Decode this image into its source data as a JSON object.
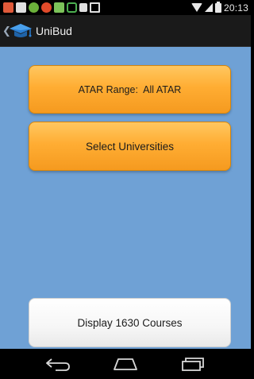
{
  "status_bar": {
    "time": "20:13",
    "notification_icons": [
      {
        "name": "app-notification-icon",
        "color": "#e05a3a"
      },
      {
        "name": "message-notification-icon",
        "color": "#e0e0e0"
      },
      {
        "name": "app-notification-icon",
        "color": "#6bb13a"
      },
      {
        "name": "app-notification-icon",
        "color": "#e04a2a"
      },
      {
        "name": "app-notification-icon",
        "color": "#7cc35a"
      },
      {
        "name": "shopping-bag-icon",
        "color": "#4caf50"
      },
      {
        "name": "notification-icon",
        "color": "#e0e0e0"
      },
      {
        "name": "inbox-icon",
        "color": "#e0e0e0"
      }
    ],
    "system_icons": [
      "wifi-icon",
      "signal-icon",
      "battery-icon"
    ]
  },
  "action_bar": {
    "title": "UniBud",
    "logo_icon": "graduation-cap-icon",
    "back_icon": "chevron-left-icon"
  },
  "main": {
    "atar_button_label": "ATAR Range:  All ATAR",
    "universities_button_label": "Select Universities",
    "display_button_label": "Display 1630 Courses"
  },
  "nav_bar": {
    "buttons": [
      "back-nav-icon",
      "home-nav-icon",
      "recent-apps-icon"
    ]
  },
  "colors": {
    "background": "#6fa1d5",
    "button_orange": "#ffad33",
    "button_white": "#f6f6f6",
    "action_bar": "#1a1a1a"
  }
}
